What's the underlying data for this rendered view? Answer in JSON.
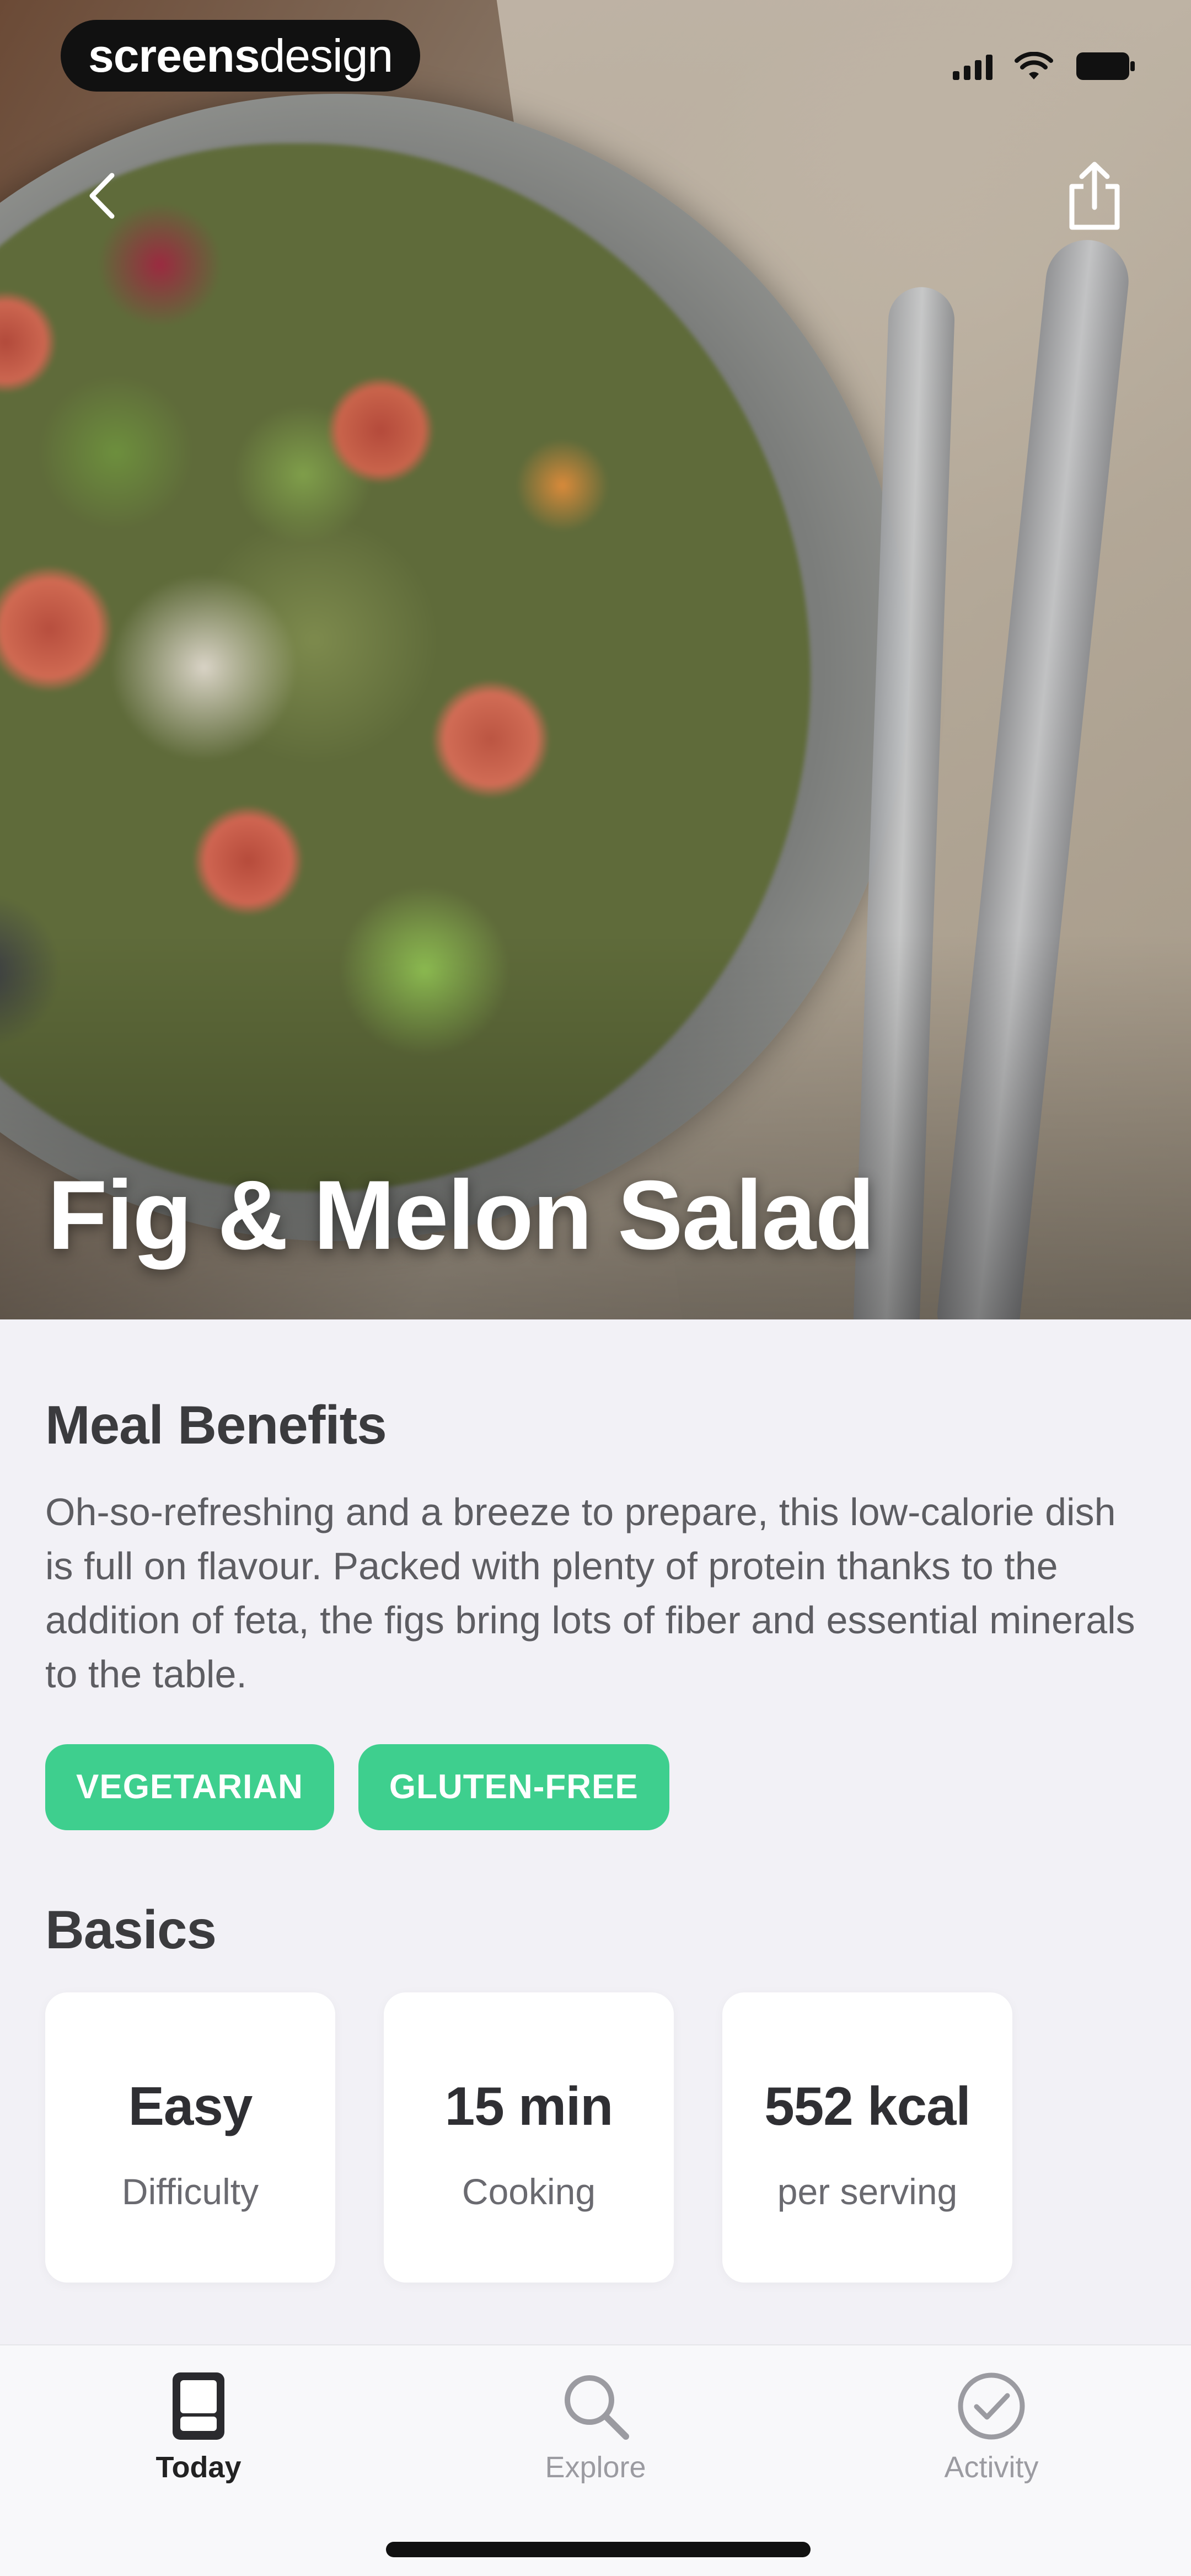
{
  "status_bar": {
    "brand_bold": "screens",
    "brand_light": "design"
  },
  "hero": {
    "title": "Fig & Melon Salad"
  },
  "meal_benefits": {
    "heading": "Meal Benefits",
    "text": "Oh-so-refreshing and a breeze to prepare, this low-calorie dish is full on flavour. Packed with plenty of protein thanks to the addition of feta, the figs bring lots of fiber and essential minerals to the table.",
    "tags": [
      "VEGETARIAN",
      "GLUTEN-FREE"
    ]
  },
  "basics": {
    "heading": "Basics",
    "cards": [
      {
        "value": "Easy",
        "label": "Difficulty"
      },
      {
        "value": "15 min",
        "label": "Cooking"
      },
      {
        "value": "552 kcal",
        "label": "per serving"
      }
    ]
  },
  "tab_bar": {
    "items": [
      {
        "label": "Today",
        "icon": "phone-card-icon",
        "active": true
      },
      {
        "label": "Explore",
        "icon": "search-icon",
        "active": false
      },
      {
        "label": "Activity",
        "icon": "checkmark-circle-icon",
        "active": false
      }
    ]
  },
  "colors": {
    "tag_green": "#3ecf8e",
    "background": "#f2f1f6"
  }
}
